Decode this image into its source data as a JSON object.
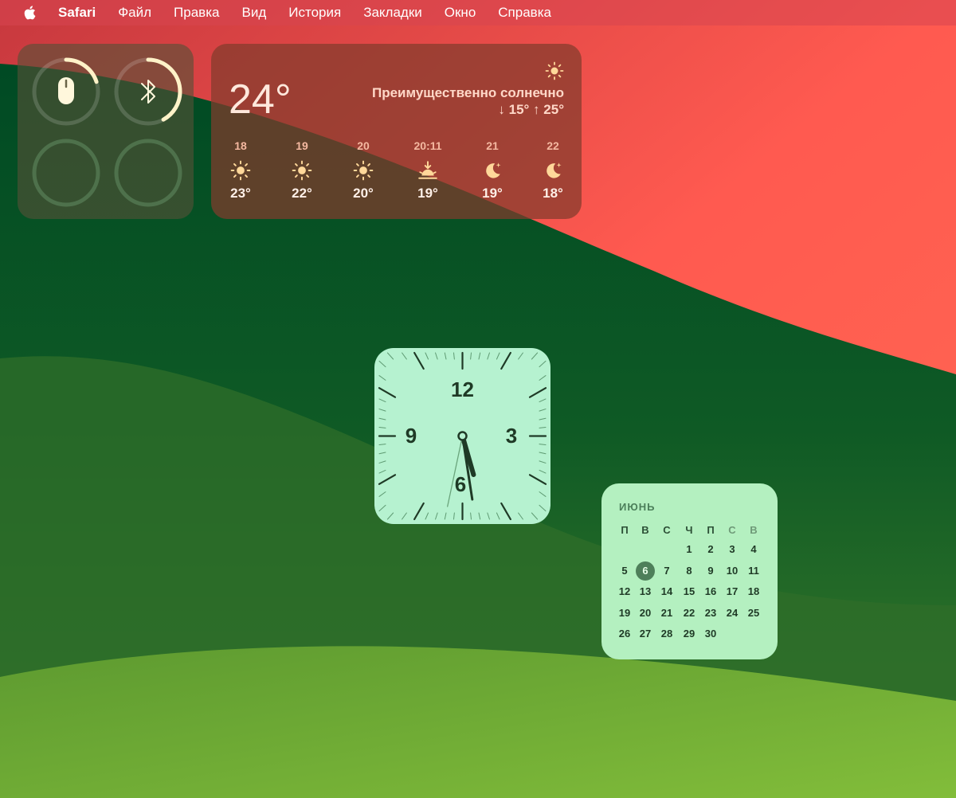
{
  "menubar": {
    "app_name": "Safari",
    "items": [
      "Файл",
      "Правка",
      "Вид",
      "История",
      "Закладки",
      "Окно",
      "Справка"
    ]
  },
  "battery_widget": {
    "devices": [
      {
        "icon": "mouse-icon",
        "level": 0.2
      },
      {
        "icon": "bluetooth-icon",
        "level": 0.42
      },
      {
        "icon": "",
        "level": 0
      },
      {
        "icon": "",
        "level": 0
      }
    ]
  },
  "weather": {
    "current_temp": "24°",
    "condition": "Преимущественно солнечно",
    "range": "↓ 15° ↑ 25°",
    "icon": "sun-icon",
    "forecast": [
      {
        "time": "18",
        "icon": "sun-icon",
        "temp": "23°"
      },
      {
        "time": "19",
        "icon": "sun-icon",
        "temp": "22°"
      },
      {
        "time": "20",
        "icon": "sun-icon",
        "temp": "20°"
      },
      {
        "time": "20:11",
        "icon": "sunset-icon",
        "temp": "19°"
      },
      {
        "time": "21",
        "icon": "moon-icon",
        "temp": "19°"
      },
      {
        "time": "22",
        "icon": "moon-icon",
        "temp": "18°"
      }
    ]
  },
  "clock": {
    "numbers": [
      "12",
      "3",
      "6",
      "9"
    ],
    "hour": 5,
    "minute": 28,
    "second": 32
  },
  "calendar": {
    "month": "ИЮНЬ",
    "weekdays": [
      "П",
      "В",
      "С",
      "Ч",
      "П",
      "С",
      "В"
    ],
    "first_weekday_index": 3,
    "days_in_month": 30,
    "today": 6
  },
  "colors": {
    "clock_face": "#b6f2d0",
    "clock_hands": "#1f3a26",
    "calendar_today": "#4e7f5a",
    "battery_ring": "#fff2c8"
  }
}
